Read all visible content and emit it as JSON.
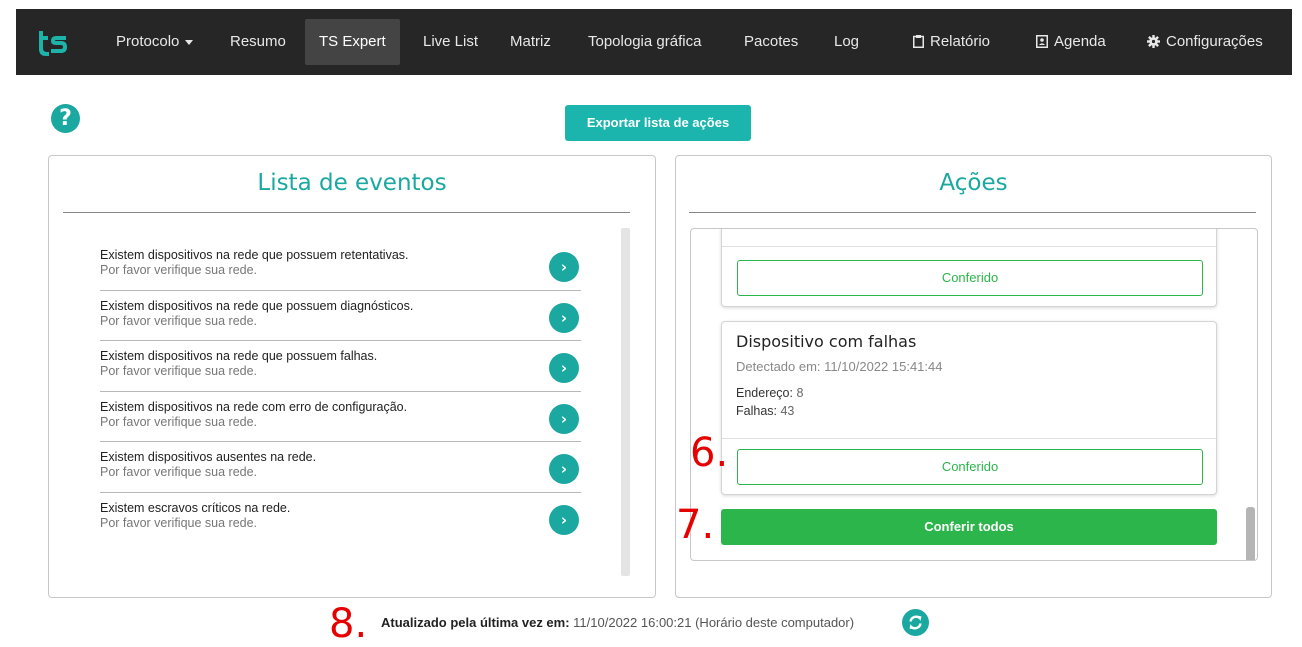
{
  "navbar": {
    "logo_text": "ts",
    "items": [
      {
        "label": "Protocolo",
        "has_caret": true
      },
      {
        "label": "Resumo"
      },
      {
        "label": "TS Expert",
        "active": true
      },
      {
        "label": "Live List"
      },
      {
        "label": "Matriz"
      },
      {
        "label": "Topologia gráfica"
      },
      {
        "label": "Pacotes"
      },
      {
        "label": "Log"
      },
      {
        "label": "Relatório",
        "icon": "clipboard-icon"
      },
      {
        "label": "Agenda",
        "icon": "contact-book-icon"
      },
      {
        "label": "Configurações",
        "icon": "gear-icon"
      }
    ]
  },
  "toolbar": {
    "help_icon": "?",
    "export_label": "Exportar lista de ações"
  },
  "events_panel": {
    "title": "Lista de eventos",
    "items": [
      {
        "title": "Existem dispositivos na rede que possuem retentativas.",
        "subtitle": "Por favor verifique sua rede."
      },
      {
        "title": "Existem dispositivos na rede que possuem diagnósticos.",
        "subtitle": "Por favor verifique sua rede."
      },
      {
        "title": "Existem dispositivos na rede que possuem falhas.",
        "subtitle": "Por favor verifique sua rede."
      },
      {
        "title": "Existem dispositivos na rede com erro de configuração.",
        "subtitle": "Por favor verifique sua rede."
      },
      {
        "title": "Existem dispositivos ausentes na rede.",
        "subtitle": "Por favor verifique sua rede."
      },
      {
        "title": "Existem escravos críticos na rede.",
        "subtitle": "Por favor verifique sua rede."
      }
    ],
    "arrow_glyph": "›"
  },
  "actions_panel": {
    "title": "Ações",
    "prev_card": {
      "button_label": "Conferido"
    },
    "card": {
      "title": "Dispositivo com falhas",
      "detected": "Detectado em: 11/10/2022 15:41:44",
      "address_label": "Endereço:",
      "address_value": "8",
      "failures_label": "Falhas:",
      "failures_value": "43",
      "button_label": "Conferido"
    },
    "check_all_label": "Conferir todos"
  },
  "annotations": [
    "6.",
    "7.",
    "8."
  ],
  "footer": {
    "updated_label": "Atualizado pela última vez em:",
    "updated_value": "11/10/2022 16:00:21 (Horário deste computador)"
  },
  "colors": {
    "teal": "#1aa8a0",
    "green": "#2bb54a",
    "navbar": "#262626",
    "annotation": "#e60000"
  }
}
